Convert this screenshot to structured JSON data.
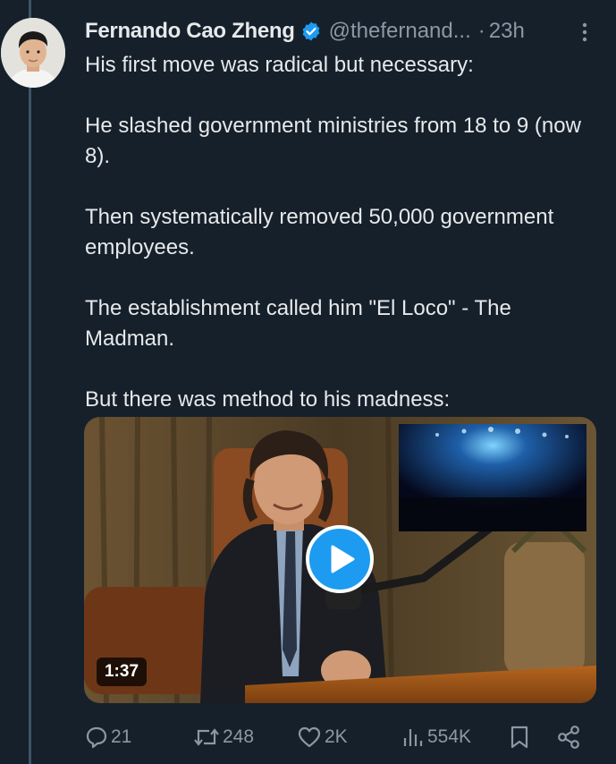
{
  "tweet": {
    "author_name": "Fernando Cao Zheng",
    "handle": "@thefernand...",
    "separator": "·",
    "time": "23h",
    "paragraphs": [
      "His first move was radical but necessary:",
      "He slashed government ministries from 18 to 9 (now 8).",
      "Then systematically removed 50,000 government employees.",
      "The establishment called him \"El Loco\" - The Madman.",
      "But there was method to his madness:"
    ]
  },
  "media": {
    "duration": "1:37"
  },
  "actions": {
    "replies": "21",
    "reposts": "248",
    "likes": "2K",
    "views": "554K"
  },
  "colors": {
    "background": "#15202b",
    "text_primary": "#e7e9ea",
    "text_secondary": "#8b98a5",
    "accent": "#1d9bf0"
  },
  "icons": [
    "verified-badge-icon",
    "more-options-icon",
    "play-icon",
    "reply-icon",
    "repost-icon",
    "like-icon",
    "views-icon",
    "bookmark-icon",
    "share-icon"
  ]
}
